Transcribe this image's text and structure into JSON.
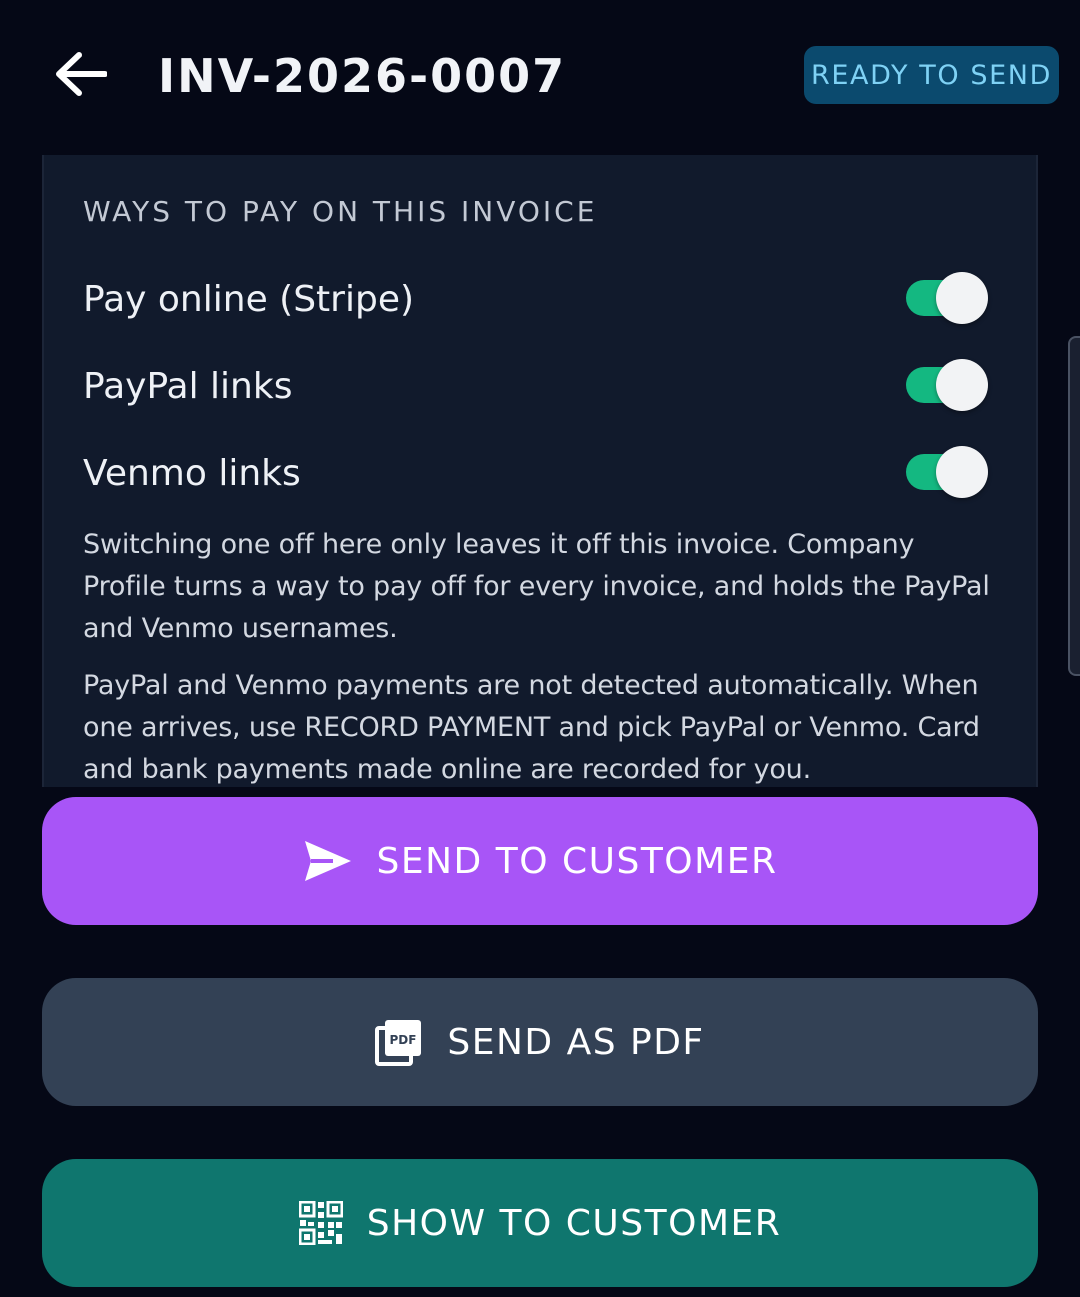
{
  "header": {
    "back_icon": "arrow-left-icon",
    "title": "INV-2026-0007",
    "status": "READY TO SEND",
    "status_color": "#0b4a6e"
  },
  "payment_options": {
    "heading": "WAYS TO PAY ON THIS INVOICE",
    "items": [
      {
        "label": "Pay online (Stripe)",
        "enabled": true
      },
      {
        "label": "PayPal links",
        "enabled": true
      },
      {
        "label": "Venmo links",
        "enabled": true
      }
    ],
    "note_1": "Switching one off here only leaves it off this invoice. Company Profile turns a way to pay off for every invoice, and holds the PayPal and Venmo usernames.",
    "note_2": "PayPal and Venmo payments are not detected automatically. When one arrives, use RECORD PAYMENT and pick PayPal or Venmo. Card and bank payments made online are recorded for you.",
    "toggle_on_color": "#14b881"
  },
  "actions": {
    "send_to_customer": {
      "label": "SEND TO CUSTOMER",
      "icon": "send-icon",
      "color": "#a855f7"
    },
    "send_as_pdf": {
      "label": "SEND AS PDF",
      "icon": "pdf-icon",
      "color": "#334155"
    },
    "show_to_customer": {
      "label": "SHOW TO CUSTOMER",
      "icon": "qr-code-icon",
      "color": "#0f766e"
    }
  }
}
